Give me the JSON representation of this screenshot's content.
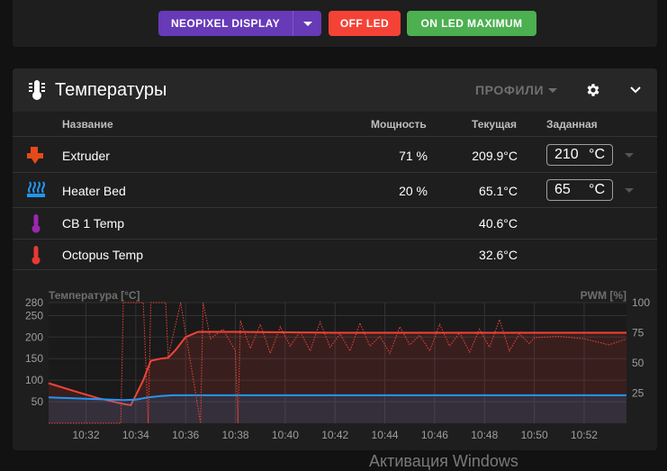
{
  "toolbar": {
    "neopixel_label": "NEOPIXEL DISPLAY",
    "off_led_label": "OFF LED",
    "on_led_max_label": "ON LED MAXIMUM",
    "neopixel_color": "#673ab7",
    "off_color": "#f44336",
    "on_color": "#4caf50"
  },
  "panel": {
    "title": "Температуры",
    "profiles_label": "ПРОФИЛИ",
    "icon": "thermometer-icon"
  },
  "table": {
    "headers": {
      "name": "Название",
      "power": "Мощность",
      "current": "Текущая",
      "target": "Заданная"
    },
    "rows": [
      {
        "name": "Extruder",
        "power": "71 %",
        "current": "209.9°C",
        "target": "210",
        "unit": "°C",
        "icon": "extruder-icon",
        "icon_color": "#e64a19"
      },
      {
        "name": "Heater Bed",
        "power": "20 %",
        "current": "65.1°C",
        "target": "65",
        "unit": "°C",
        "icon": "heater-bed-icon",
        "icon_color": "#2196f3"
      },
      {
        "name": "CB 1 Temp",
        "power": "",
        "current": "40.6°C",
        "icon": "thermometer-icon",
        "icon_color": "#9c27b0"
      },
      {
        "name": "Octopus Temp",
        "power": "",
        "current": "32.6°C",
        "icon": "thermometer-icon",
        "icon_color": "#e53935"
      }
    ]
  },
  "chart_data": {
    "type": "line",
    "ylabel": "Температура [°C]",
    "y2label": "PWM [%]",
    "ylim": [
      0,
      280
    ],
    "y2lim": [
      0,
      100
    ],
    "yticks": [
      50,
      100,
      150,
      200,
      250,
      280
    ],
    "y2ticks": [
      25,
      50,
      75,
      100
    ],
    "xticks": [
      "10:32",
      "10:34",
      "10:36",
      "10:38",
      "10:40",
      "10:42",
      "10:44",
      "10:46",
      "10:48",
      "10:50",
      "10:52"
    ],
    "x_minutes": [
      32,
      34,
      36,
      38,
      40,
      42,
      44,
      46,
      48,
      50,
      52
    ],
    "xlim": [
      30.5,
      53.7
    ],
    "grid": true,
    "series": [
      {
        "color": "#f44336",
        "axis": "temp",
        "x": [
          30.5,
          31.5,
          32.5,
          33.5,
          33.8,
          34.0,
          34.3,
          34.6,
          35.0,
          35.3,
          35.6,
          36.0,
          36.5,
          37.0,
          37.5,
          38.0,
          40,
          42,
          44,
          46,
          48,
          50,
          52,
          53.7
        ],
        "y": [
          93,
          75,
          58,
          45,
          42,
          65,
          100,
          145,
          150,
          152,
          170,
          200,
          212,
          212,
          212,
          212,
          211,
          210,
          210,
          210,
          210,
          210,
          210,
          210
        ]
      },
      {
        "color": "#2196f3",
        "axis": "temp",
        "x": [
          30.5,
          31.5,
          32.5,
          33.5,
          34.0,
          34.5,
          35.0,
          35.5,
          36.0,
          38.0,
          42.0,
          46.0,
          50.0,
          53.7
        ],
        "y": [
          60,
          58,
          56,
          54,
          55,
          60,
          63,
          65,
          65,
          65,
          65,
          65,
          65,
          65
        ]
      },
      {
        "color": "#f44336",
        "axis": "pwm",
        "style": "dotted",
        "x": [
          30.5,
          33.4,
          33.5,
          33.7,
          34.0,
          34.3,
          34.5,
          34.6,
          35.2,
          35.3,
          35.8,
          36.0,
          36.6,
          36.7,
          37.0,
          37.5,
          38.0,
          38.1,
          38.2,
          38.6,
          39.0,
          39.4,
          39.8,
          40.2,
          40.6,
          41.0,
          41.4,
          41.8,
          42.2,
          42.6,
          43.0,
          43.4,
          43.8,
          44.2,
          44.6,
          45.0,
          45.4,
          45.8,
          46.2,
          46.6,
          47.0,
          47.4,
          47.8,
          48.2,
          48.6,
          49.0,
          49.4,
          49.8,
          50.0,
          51.0,
          52.0,
          53.0,
          53.7
        ],
        "y": [
          0,
          0,
          100,
          100,
          100,
          100,
          0,
          100,
          100,
          55,
          100,
          75,
          0,
          100,
          70,
          78,
          60,
          0,
          85,
          62,
          82,
          58,
          80,
          64,
          76,
          60,
          84,
          63,
          74,
          60,
          83,
          64,
          72,
          58,
          80,
          65,
          73,
          60,
          82,
          64,
          75,
          59,
          78,
          63,
          86,
          60,
          74,
          66,
          71,
          72,
          70,
          65,
          70
        ]
      }
    ]
  },
  "watermark": "Активация Windows"
}
